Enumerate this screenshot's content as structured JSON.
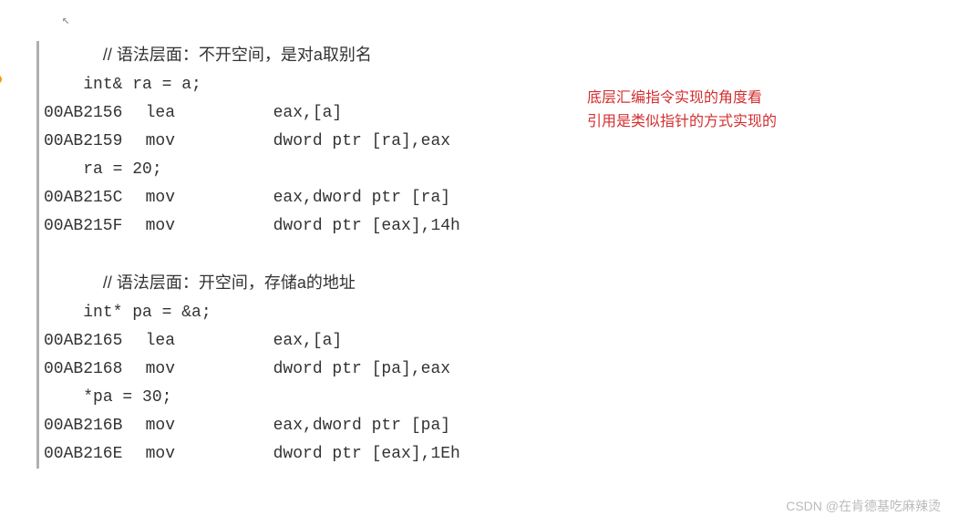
{
  "code": {
    "comment1": "// 语法层面：不开空间，是对a取别名",
    "src1": "int& ra = a;",
    "asm1_addr": "00AB2156",
    "asm1_op": "lea",
    "asm1_args": "eax,[a]",
    "asm2_addr": "00AB2159",
    "asm2_op": "mov",
    "asm2_args": "dword ptr [ra],eax",
    "src2": "ra = 20;",
    "asm3_addr": "00AB215C",
    "asm3_op": "mov",
    "asm3_args": "eax,dword ptr [ra]",
    "asm4_addr": "00AB215F",
    "asm4_op": "mov",
    "asm4_args": "dword ptr [eax],14h",
    "comment2": "// 语法层面：开空间，存储a的地址",
    "src3": "int* pa = &a;",
    "asm5_addr": "00AB2165",
    "asm5_op": "lea",
    "asm5_args": "eax,[a]",
    "asm6_addr": "00AB2168",
    "asm6_op": "mov",
    "asm6_args": "dword ptr [pa],eax",
    "src4": "*pa = 30;",
    "asm7_addr": "00AB216B",
    "asm7_op": "mov",
    "asm7_args": "eax,dword ptr [pa]",
    "asm8_addr": "00AB216E",
    "asm8_op": "mov",
    "asm8_args": "dword ptr [eax],1Eh"
  },
  "annotation": {
    "line1": "底层汇编指令实现的角度看",
    "line2": "引用是类似指针的方式实现的"
  },
  "watermark": "CSDN @在肯德基吃麻辣烫"
}
